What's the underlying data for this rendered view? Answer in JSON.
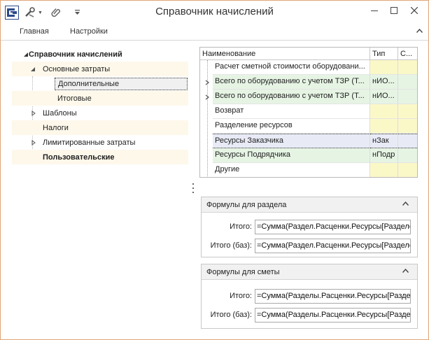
{
  "window": {
    "title": "Справочник начислений"
  },
  "ribbon": {
    "tabs": [
      "Главная",
      "Настройки"
    ]
  },
  "tree": {
    "items": [
      {
        "label": "Справочник начислений",
        "bold": true,
        "expanded": true
      },
      {
        "label": "Основные затраты",
        "expanded": true
      },
      {
        "label": "Дополнительные",
        "selected": true
      },
      {
        "label": "Итоговые"
      },
      {
        "label": "Шаблоны",
        "collapsed": true
      },
      {
        "label": "Налоги"
      },
      {
        "label": "Лимитированные затраты",
        "collapsed": true
      },
      {
        "label": "Пользовательские",
        "bold": true
      }
    ]
  },
  "grid": {
    "columns": [
      "Наименование",
      "Тип",
      "С..."
    ],
    "rows": [
      {
        "name": "Расчет сметной стоимости оборудовани...",
        "type": "",
        "c3": ""
      },
      {
        "name": "Всего по оборудованию с учетом ТЗР (Т...",
        "type": "нИО...",
        "c3": "",
        "expandable": true
      },
      {
        "name": "Всего по оборудованию с учетом ТЗР (Т...",
        "type": "нИО...",
        "c3": "",
        "expandable": true
      },
      {
        "name": "Возврат",
        "type": "",
        "c3": ""
      },
      {
        "name": "Разделение ресурсов",
        "type": "",
        "c3": ""
      },
      {
        "name": "Ресурсы Заказчика",
        "type": "нЗак",
        "c3": ""
      },
      {
        "name": "Ресурсы Подрядчика",
        "type": "нПодр",
        "c3": ""
      },
      {
        "name": "Другие",
        "type": "",
        "c3": ""
      }
    ]
  },
  "section_formulas": {
    "title": "Формулы для раздела",
    "total_label": "Итого:",
    "total_value": "=Сумма(Раздел.Расценки.Ресурсы[Разделе",
    "base_label": "Итого (баз):",
    "base_value": "=Сумма(Раздел.Расценки.Ресурсы[Разделе"
  },
  "estimate_formulas": {
    "title": "Формулы для сметы",
    "total_label": "Итого:",
    "total_value": "=Сумма(Разделы.Расценки.Ресурсы[Раздел",
    "base_label": "Итого (баз):",
    "base_value": "=Сумма(Разделы.Расценки.Ресурсы[Раздел"
  },
  "colors": {
    "window_border": "#e0a676",
    "tree_alt": "#fdf8ea",
    "type_cell": "#fbf8c8",
    "green_row": "#e6f4e4",
    "focused_row": "#e8ebf6"
  },
  "icons": {
    "app": "app-logo-icon",
    "tools": "tools-icon",
    "clip": "paperclip-icon",
    "qat_menu": "customize-qat-icon",
    "minimize": "minimize-icon",
    "maximize": "maximize-icon",
    "close": "close-icon",
    "collapse_ribbon": "chevron-up-icon"
  }
}
